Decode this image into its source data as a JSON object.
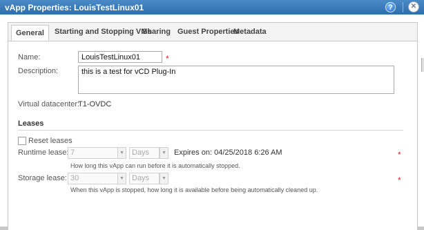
{
  "window": {
    "title": "vApp Properties: LouisTestLinux01",
    "help_glyph": "?",
    "close_glyph": "✕"
  },
  "tabs": [
    {
      "label": "General",
      "active": true
    },
    {
      "label": "Starting and Stopping VMs",
      "active": false
    },
    {
      "label": "Sharing",
      "active": false
    },
    {
      "label": "Guest Properties",
      "active": false
    },
    {
      "label": "Metadata",
      "active": false
    }
  ],
  "general": {
    "name_label": "Name:",
    "name_value": "LouisTestLinux01",
    "required_mark": "*",
    "description_label": "Description:",
    "description_value": "this is a test for vCD Plug-In",
    "vdc_label": "Virtual datacenter:",
    "vdc_value": "T1-OVDC"
  },
  "leases": {
    "section_title": "Leases",
    "reset_label": "Reset leases",
    "runtime_label": "Runtime lease:",
    "runtime_value": "7",
    "runtime_unit": "Days",
    "runtime_expires": "Expires on: 04/25/2018 6:26 AM",
    "runtime_hint": "How long this vApp can run before it is automatically stopped.",
    "storage_label": "Storage lease:",
    "storage_value": "30",
    "storage_unit": "Days",
    "storage_hint": "When this vApp is stopped, how long it is available before being automatically cleaned up.",
    "required_mark": "*"
  }
}
